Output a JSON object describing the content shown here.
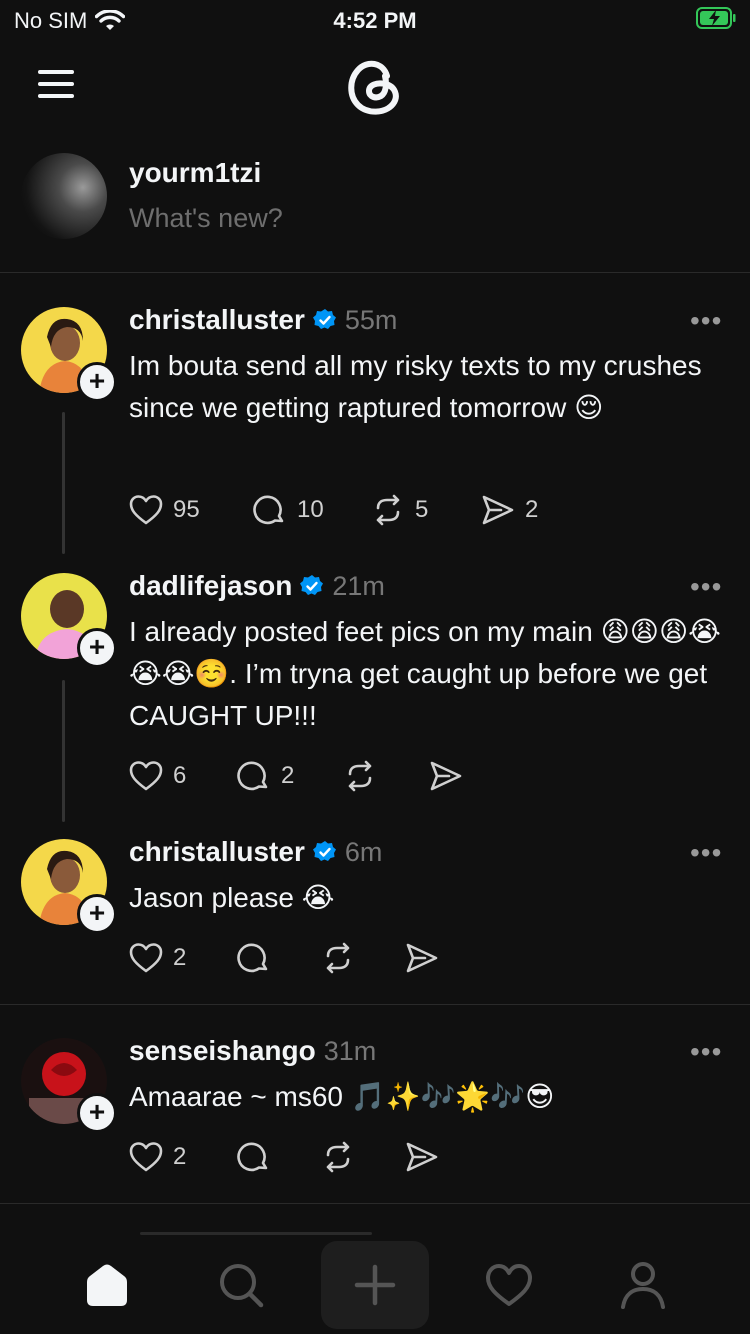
{
  "status_bar": {
    "carrier": "No SIM",
    "time": "4:52 PM"
  },
  "composer": {
    "username": "yourm1tzi",
    "placeholder": "What's new?"
  },
  "posts": [
    {
      "username": "christalluster",
      "verified": true,
      "time": "55m",
      "text": "Im bouta send all my risky texts to my crushes since we getting raptured tomorrow 😌",
      "likes": "95",
      "replies": "10",
      "reposts": "5",
      "shares": "2"
    },
    {
      "username": "dadlifejason",
      "verified": true,
      "time": "21m",
      "text": "I already posted feet pics on my main 😩😩😩😭😭😭☺️. I’m tryna get caught up before we get CAUGHT UP!!!",
      "likes": "6",
      "replies": "2",
      "reposts": "",
      "shares": ""
    },
    {
      "username": "christalluster",
      "verified": true,
      "time": "6m",
      "text": "Jason please 😭",
      "likes": "2",
      "replies": "",
      "reposts": "",
      "shares": ""
    },
    {
      "username": "senseishango",
      "verified": false,
      "time": "31m",
      "text": "Amaarae ~ ms60 🎵✨🎶🌟🎶😎",
      "likes": "2",
      "replies": "",
      "reposts": "",
      "shares": ""
    }
  ],
  "more_label": "•••",
  "colors": {
    "background": "#101010",
    "verified_blue": "#0095f6",
    "battery_green": "#34c759"
  },
  "icons": [
    "wifi-icon",
    "battery-icon",
    "menu-icon",
    "threads-logo-icon",
    "heart-icon",
    "reply-icon",
    "repost-icon",
    "share-icon",
    "home-icon",
    "search-icon",
    "plus-icon",
    "activity-icon",
    "profile-icon"
  ]
}
